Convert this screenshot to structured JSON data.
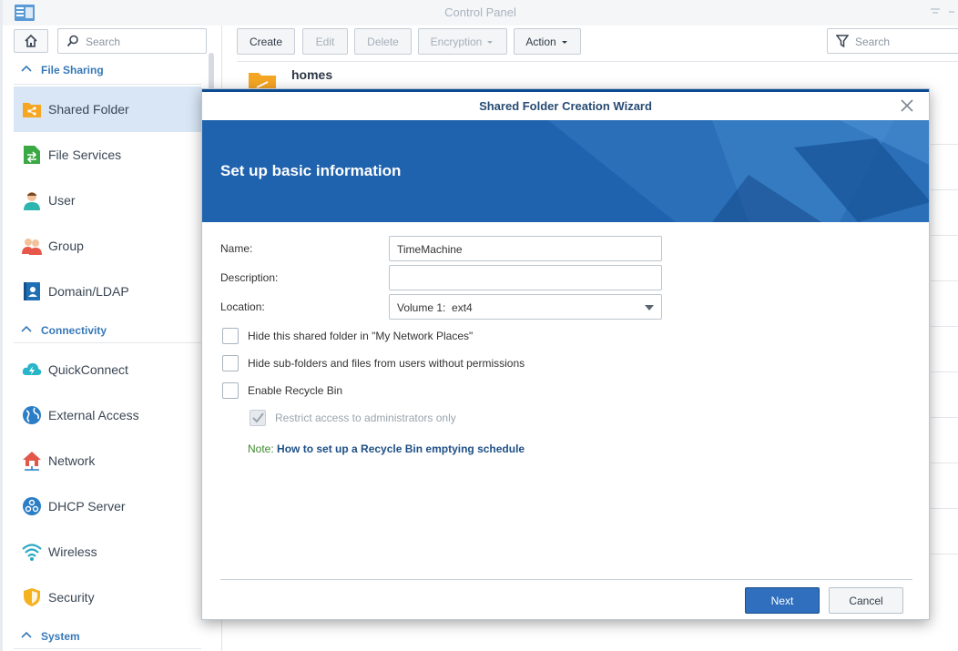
{
  "window": {
    "title": "Control Panel"
  },
  "sidebar": {
    "search_placeholder": "Search",
    "sections": [
      {
        "label": "File Sharing"
      },
      {
        "label": "Connectivity"
      },
      {
        "label": "System"
      }
    ],
    "items": [
      {
        "label": "Shared Folder",
        "icon": "shared-folder-icon",
        "selected": true
      },
      {
        "label": "File Services",
        "icon": "file-services-icon"
      },
      {
        "label": "User",
        "icon": "user-icon"
      },
      {
        "label": "Group",
        "icon": "group-icon"
      },
      {
        "label": "Domain/LDAP",
        "icon": "domain-ldap-icon"
      },
      {
        "label": "QuickConnect",
        "icon": "quickconnect-icon"
      },
      {
        "label": "External Access",
        "icon": "external-access-icon"
      },
      {
        "label": "Network",
        "icon": "network-icon"
      },
      {
        "label": "DHCP Server",
        "icon": "dhcp-server-icon"
      },
      {
        "label": "Wireless",
        "icon": "wireless-icon"
      },
      {
        "label": "Security",
        "icon": "security-icon"
      }
    ]
  },
  "toolbar": {
    "create": "Create",
    "edit": "Edit",
    "delete": "Delete",
    "encryption": "Encryption",
    "action": "Action",
    "search_placeholder": "Search"
  },
  "list": {
    "rows": [
      {
        "name": "homes"
      }
    ]
  },
  "wizard": {
    "title": "Shared Folder Creation Wizard",
    "step_title": "Set up basic information",
    "form": {
      "name_label": "Name:",
      "name_value": "TimeMachine",
      "description_label": "Description:",
      "description_value": "",
      "location_label": "Location:",
      "location_value": "Volume 1:  ext4"
    },
    "options": [
      {
        "label": "Hide this shared folder in \"My Network Places\"",
        "checked": false
      },
      {
        "label": "Hide sub-folders and files from users without permissions",
        "checked": false
      },
      {
        "label": "Enable Recycle Bin",
        "checked": false
      },
      {
        "label": "Restrict access to administrators only",
        "checked": true,
        "disabled": true
      }
    ],
    "note_prefix": "Note:",
    "note_link": "How to set up a Recycle Bin emptying schedule",
    "next_label": "Next",
    "cancel_label": "Cancel"
  },
  "colors": {
    "accent": "#2f6fbd",
    "banner": "#1f62ad",
    "section_header": "#3779b8",
    "note_green": "#3d8a2f"
  }
}
